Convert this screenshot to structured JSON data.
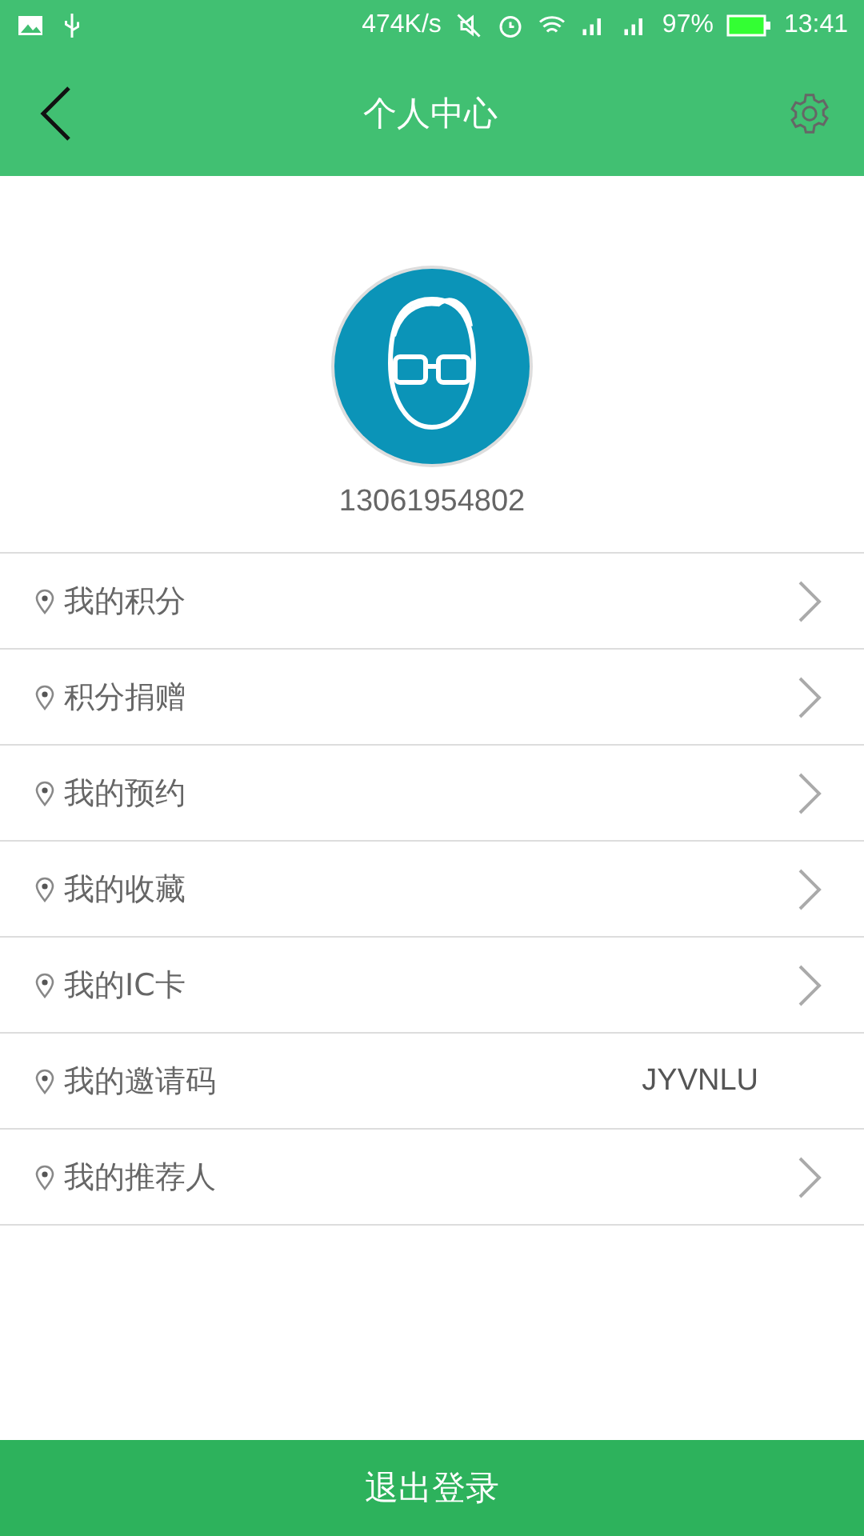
{
  "status_bar": {
    "speed": "474K/s",
    "battery": "97%",
    "time": "13:41"
  },
  "header": {
    "title": "个人中心"
  },
  "profile": {
    "phone": "13061954802"
  },
  "menu": [
    {
      "kind": "link",
      "label": "我的积分"
    },
    {
      "kind": "link",
      "label": "积分捐赠"
    },
    {
      "kind": "link",
      "label": "我的预约"
    },
    {
      "kind": "link",
      "label": "我的收藏"
    },
    {
      "kind": "link",
      "label": "我的IC卡"
    },
    {
      "kind": "value",
      "label": "我的邀请码",
      "value": "JYVNLU"
    },
    {
      "kind": "link",
      "label": "我的推荐人"
    }
  ],
  "logout_button": "退出登录"
}
